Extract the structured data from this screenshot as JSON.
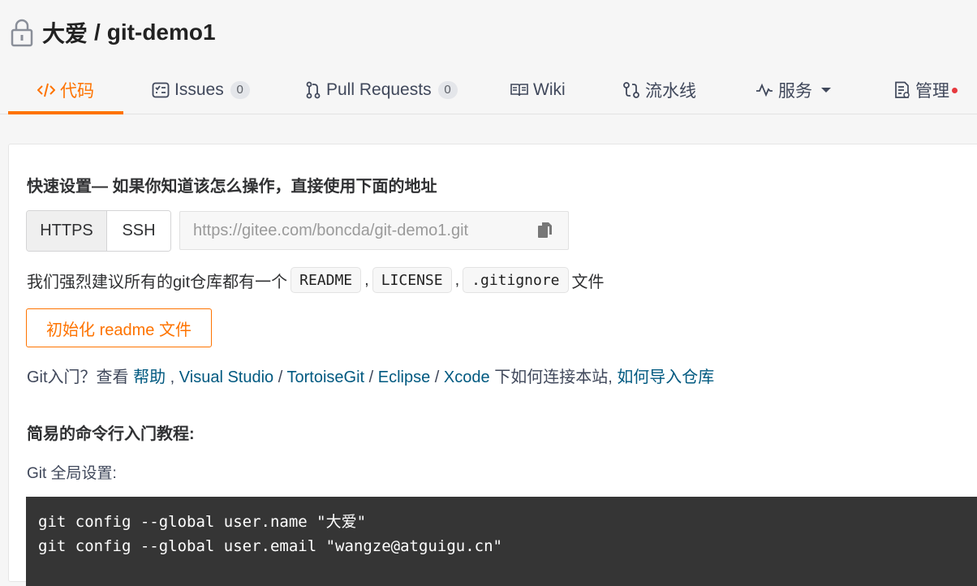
{
  "repo": {
    "owner": "大爱",
    "separator": "/",
    "name": "git-demo1"
  },
  "tabs": [
    {
      "label": "代码",
      "icon": "code-icon",
      "active": true
    },
    {
      "label": "Issues",
      "icon": "issues-icon",
      "count": "0"
    },
    {
      "label": "Pull Requests",
      "icon": "pull-request-icon",
      "count": "0"
    },
    {
      "label": "Wiki",
      "icon": "wiki-book-icon"
    },
    {
      "label": "流水线",
      "icon": "pipeline-icon"
    },
    {
      "label": "服务",
      "icon": "pulse-icon",
      "dropdown": true
    },
    {
      "label": "管理",
      "icon": "manage-doc-icon",
      "notification_dot": true
    }
  ],
  "quick_setup": {
    "title": "快速设置— 如果你知道该怎么操作，直接使用下面的地址",
    "protocols": [
      "HTTPS",
      "SSH"
    ],
    "selected_protocol": "HTTPS",
    "url": "https://gitee.com/boncda/git-demo1.git",
    "copy_icon": "copy-icon"
  },
  "recommend": {
    "prefix": "我们强烈建议所有的git仓库都有一个",
    "files": [
      "README",
      "LICENSE",
      ".gitignore"
    ],
    "sep": ",",
    "suffix": "文件"
  },
  "init_button": "初始化 readme 文件",
  "help_line": {
    "prefix": "Git入门？查看 ",
    "help": "帮助",
    "comma1": " , ",
    "vs": "Visual Studio",
    "slash1": " / ",
    "tortoise": "TortoiseGit",
    "slash2": " / ",
    "eclipse": "Eclipse",
    "slash3": " / ",
    "xcode": "Xcode",
    "middle": " 下如何连接本站, ",
    "import": "如何导入仓库"
  },
  "cmd_title": "简易的命令行入门教程:",
  "git_global_label": "Git 全局设置:",
  "code_lines": [
    "git config --global user.name \"大爱\"",
    "git config --global user.email \"wangze@atguigu.cn\""
  ],
  "colors": {
    "accent": "#fe7300",
    "link": "#005980",
    "code_bg": "#353535",
    "notification": "#e6393e"
  }
}
